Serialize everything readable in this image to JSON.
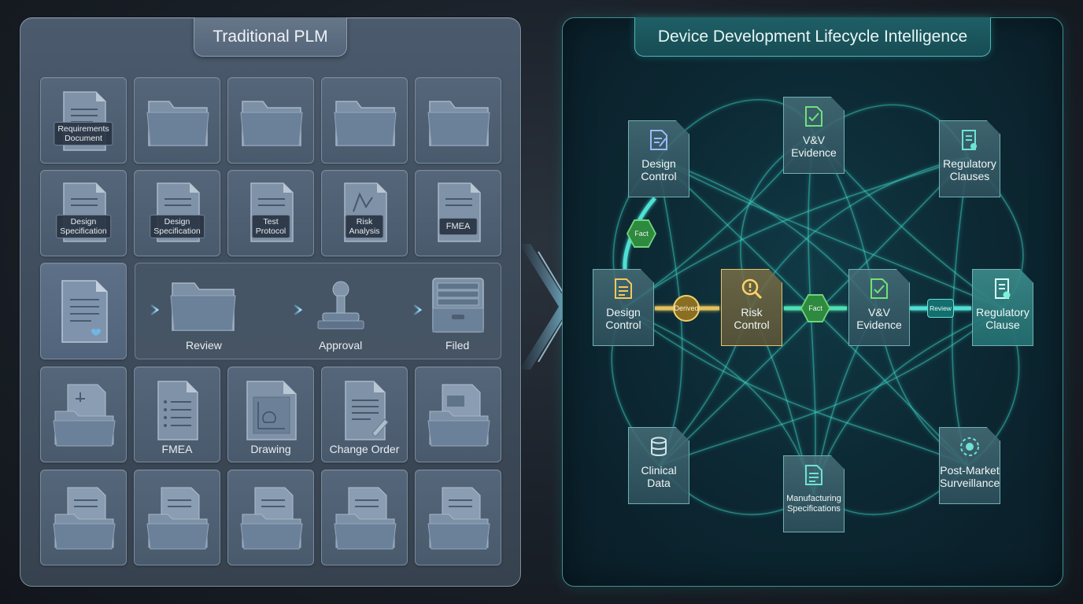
{
  "left_panel": {
    "title": "Traditional PLM",
    "row1": [
      {
        "tag": "Requirements Document",
        "tag_lines": [
          "Requirements",
          "Document"
        ]
      },
      {
        "tag": ""
      },
      {
        "tag": ""
      },
      {
        "tag": ""
      },
      {
        "tag": ""
      }
    ],
    "row2": [
      {
        "tag_lines": [
          "Design",
          "Specification"
        ]
      },
      {
        "tag_lines": [
          "Design",
          "Specification"
        ]
      },
      {
        "tag_lines": [
          "Test",
          "Protocol"
        ]
      },
      {
        "tag_lines": [
          "Risk",
          "Analysis"
        ]
      },
      {
        "tag_lines": [
          "FMEA"
        ]
      }
    ],
    "workflow": {
      "review": "Review",
      "approval": "Approval",
      "filed": "Filed"
    },
    "row4": [
      {
        "caption": ""
      },
      {
        "caption": "FMEA"
      },
      {
        "caption": "Drawing"
      },
      {
        "caption": "Change Order"
      },
      {
        "caption": ""
      }
    ]
  },
  "right_panel": {
    "title": "Device Development Lifecycle Intelligence",
    "nodes": {
      "design_control_top": [
        "Design",
        "Control"
      ],
      "vv_evidence_top": [
        "V&V",
        "Evidence"
      ],
      "regulatory_clauses": [
        "Regulatory",
        "Clauses"
      ],
      "design_control_mid": [
        "Design",
        "Control"
      ],
      "risk_control": [
        "Risk",
        "Control"
      ],
      "vv_evidence_mid": [
        "V&V",
        "Evidence"
      ],
      "regulatory_clause": [
        "Regulatory",
        "Clause"
      ],
      "clinical_data": [
        "Clinical",
        "Data"
      ],
      "manufacturing_specs": [
        "Manufacturing",
        "Specifications"
      ],
      "post_market": [
        "Post-Market",
        "Surveillance"
      ]
    },
    "edge_labels": {
      "fact_top": "Fact",
      "derived": "Derived",
      "fact_mid": "Fact",
      "review": "Review"
    }
  },
  "colors": {
    "left_bg": "#4b5b6d",
    "right_bg": "#0c2833",
    "glow": "#4fe0d4",
    "risk": "#e7c46a",
    "fact": "#2e8a3e"
  }
}
